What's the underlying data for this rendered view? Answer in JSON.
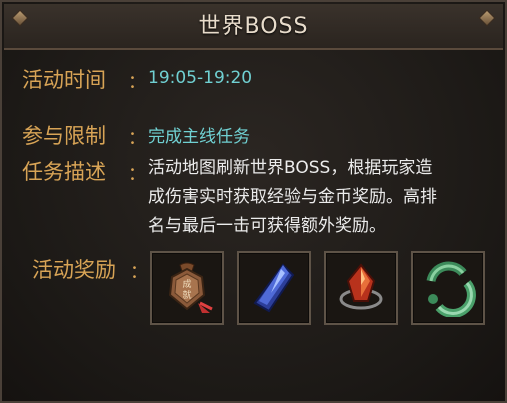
{
  "header": {
    "title": "世界BOSS"
  },
  "fields": {
    "time": {
      "label": "活动时间",
      "colon": "：",
      "value": "19:05-19:20"
    },
    "limit": {
      "label": "参与限制",
      "colon": "：",
      "value": "完成主线任务"
    },
    "desc": {
      "label": "任务描述",
      "colon": "：",
      "lines": [
        "活动地图刷新世界BOSS，根据玩家造",
        "成伤害实时获取经验与金币奖励。高排",
        "名与最后一击可获得额外奖励。"
      ]
    },
    "reward": {
      "label": "活动奖励",
      "colon": "："
    }
  },
  "rewards": [
    {
      "icon": "achievement-token-icon",
      "glyph_text": "成就"
    },
    {
      "icon": "blue-crystal-icon"
    },
    {
      "icon": "red-gem-icon"
    },
    {
      "icon": "jade-ring-icon"
    }
  ],
  "colors": {
    "label": "#d8a456",
    "value": "#70d0d2",
    "desc": "#ececec",
    "title": "#e8dccb"
  }
}
